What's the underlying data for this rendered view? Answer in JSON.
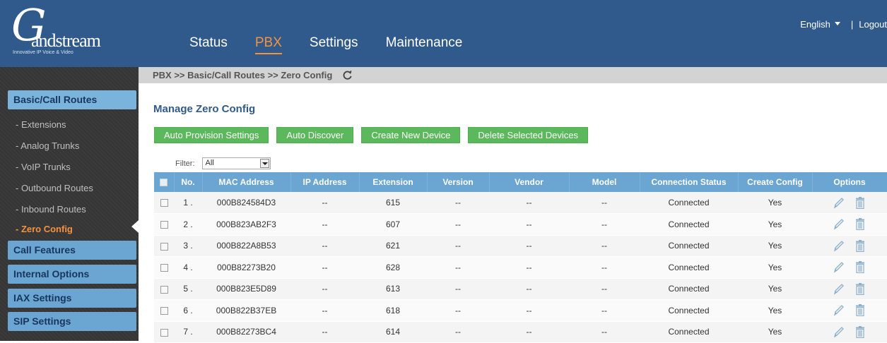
{
  "brand": {
    "logo_letter": "G",
    "logo_word": "andstream",
    "tagline": "Innovative IP Voice & Video"
  },
  "nav": [
    {
      "label": "Status",
      "active": false
    },
    {
      "label": "PBX",
      "active": true
    },
    {
      "label": "Settings",
      "active": false
    },
    {
      "label": "Maintenance",
      "active": false
    }
  ],
  "top_right": {
    "language": "English",
    "separator": "|",
    "logout": "Logout"
  },
  "breadcrumb": "PBX >> Basic/Call Routes >> Zero Config",
  "sidebar": {
    "sections": [
      {
        "label": "Basic/Call Routes"
      },
      {
        "label": "Call Features"
      },
      {
        "label": "Internal Options"
      },
      {
        "label": "IAX Settings"
      },
      {
        "label": "SIP Settings"
      }
    ],
    "subitems": [
      {
        "label": "- Extensions"
      },
      {
        "label": "- Analog Trunks"
      },
      {
        "label": "- VoIP Trunks"
      },
      {
        "label": "- Outbound Routes"
      },
      {
        "label": "- Inbound Routes"
      },
      {
        "label": "- Zero Config",
        "active": true
      }
    ]
  },
  "page_title": "Manage Zero Config",
  "buttons": [
    {
      "label": "Auto Provision Settings"
    },
    {
      "label": "Auto Discover"
    },
    {
      "label": "Create New Device"
    },
    {
      "label": "Delete Selected Devices"
    }
  ],
  "filter": {
    "label": "Filter:",
    "value": "All"
  },
  "table": {
    "columns": [
      "No.",
      "MAC Address",
      "IP Address",
      "Extension",
      "Version",
      "Vendor",
      "Model",
      "Connection Status",
      "Create Config",
      "Options"
    ],
    "rows": [
      {
        "no": "1 .",
        "mac": "000B824584D3",
        "ip": "--",
        "ext": "615",
        "version": "--",
        "vendor": "--",
        "model": "--",
        "status": "Connected",
        "config": "Yes"
      },
      {
        "no": "2 .",
        "mac": "000B823AB2F3",
        "ip": "--",
        "ext": "607",
        "version": "--",
        "vendor": "--",
        "model": "--",
        "status": "Connected",
        "config": "Yes"
      },
      {
        "no": "3 .",
        "mac": "000B822A8B53",
        "ip": "--",
        "ext": "621",
        "version": "--",
        "vendor": "--",
        "model": "--",
        "status": "Connected",
        "config": "Yes"
      },
      {
        "no": "4 .",
        "mac": "000B82273B20",
        "ip": "--",
        "ext": "628",
        "version": "--",
        "vendor": "--",
        "model": "--",
        "status": "Connected",
        "config": "Yes"
      },
      {
        "no": "5 .",
        "mac": "000B823E5D89",
        "ip": "--",
        "ext": "613",
        "version": "--",
        "vendor": "--",
        "model": "--",
        "status": "Connected",
        "config": "Yes"
      },
      {
        "no": "6 .",
        "mac": "000B822B37EB",
        "ip": "--",
        "ext": "618",
        "version": "--",
        "vendor": "--",
        "model": "--",
        "status": "Connected",
        "config": "Yes"
      },
      {
        "no": "7 .",
        "mac": "000B82273BC4",
        "ip": "--",
        "ext": "614",
        "version": "--",
        "vendor": "--",
        "model": "--",
        "status": "Connected",
        "config": "Yes"
      }
    ]
  },
  "icons": {
    "refresh": "refresh-icon",
    "edit": "edit-icon",
    "delete": "trash-icon",
    "language_dropdown": "caret-down-icon"
  },
  "colors": {
    "header_bg": "#2f5a8b",
    "nav_active": "#f5923e",
    "sidebar_section": "#6ba5d1",
    "button_green": "#5cb85c",
    "table_header": "#6ba5d1"
  }
}
